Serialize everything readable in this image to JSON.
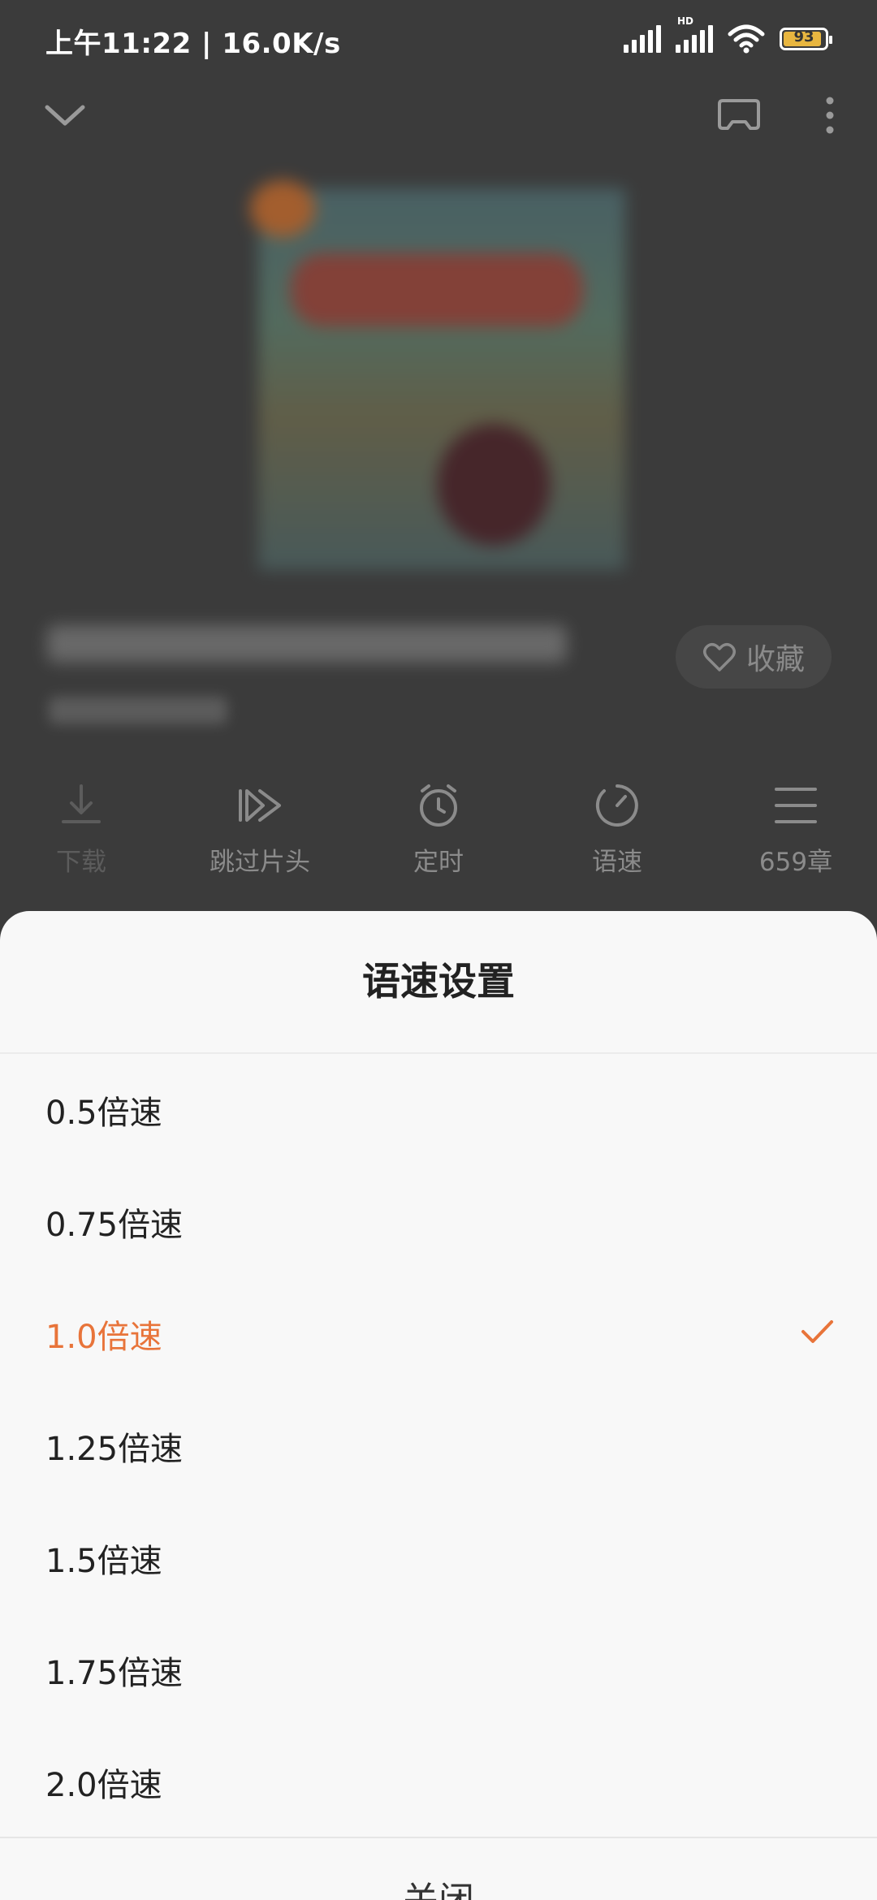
{
  "status_bar": {
    "time_speed": "上午11:22 | 16.0K/s",
    "network_tag": "HD",
    "battery": "93"
  },
  "player": {
    "favorite_label": "收藏",
    "actions": [
      {
        "label": "下载",
        "icon": "download-icon"
      },
      {
        "label": "跳过片头",
        "icon": "skip-intro-icon"
      },
      {
        "label": "定时",
        "icon": "alarm-clock-icon"
      },
      {
        "label": "语速",
        "icon": "speed-dial-icon"
      },
      {
        "label": "659章",
        "icon": "list-icon"
      }
    ]
  },
  "speed_sheet": {
    "title": "语速设置",
    "options": [
      "0.5倍速",
      "0.75倍速",
      "1.0倍速",
      "1.25倍速",
      "1.5倍速",
      "1.75倍速",
      "2.0倍速"
    ],
    "selected": "1.0倍速",
    "close_label": "关闭",
    "accent_color": "#e8743a"
  }
}
